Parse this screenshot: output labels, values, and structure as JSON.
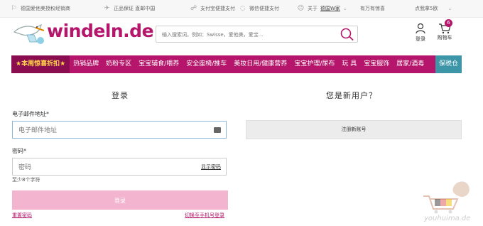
{
  "topbar": {
    "items": [
      {
        "icon": "flag-icon",
        "text": "德国爱他美授权经销商"
      },
      {
        "icon": "plane-icon",
        "text": "正品保证 直邮中国"
      },
      {
        "icon": "handshake-icon",
        "text": "支付宝便捷支付"
      },
      {
        "icon": "chat-icon",
        "text": "微信便捷支付"
      },
      {
        "icon": "person-icon",
        "text_prefix": "关于",
        "text_link": "德国W家"
      },
      {
        "icon": "",
        "text": "有万有惊喜"
      },
      {
        "icon": "",
        "text": "点我拿5欧"
      }
    ]
  },
  "header": {
    "logo_text": "windeln.de",
    "search_placeholder": "输入搜索词，例如：Swisse，爱他美，爱宝...",
    "login_label": "登录",
    "cart_label": "购物车",
    "cart_count": "6"
  },
  "nav": {
    "hot_label": "★本周惊喜折扣★",
    "items": [
      "热销品牌",
      "奶粉专区",
      "宝宝辅食/喂养",
      "安全座椅/推车",
      "美妆日用/健康营养",
      "宝宝护理/尿布",
      "玩 具",
      "宝宝服饰",
      "居家/酒毒"
    ],
    "tax_label": "保税仓"
  },
  "login": {
    "title": "登录",
    "email_label": "电子邮件地址*",
    "email_placeholder": "电子邮件地址",
    "password_label": "密码*",
    "password_placeholder": "密码",
    "show_password": "显示密码",
    "password_hint": "至少8个字符",
    "submit": "登录",
    "reset_link": "重置密码",
    "switch_link": "切换至手机号登录"
  },
  "register": {
    "title": "您是新用户？",
    "button": "注册新账号"
  },
  "watermark": "youhuima.de",
  "colors": {
    "brand": "#b5166b",
    "login_button": "#f2b4cf",
    "tax": "#3d95a8"
  }
}
